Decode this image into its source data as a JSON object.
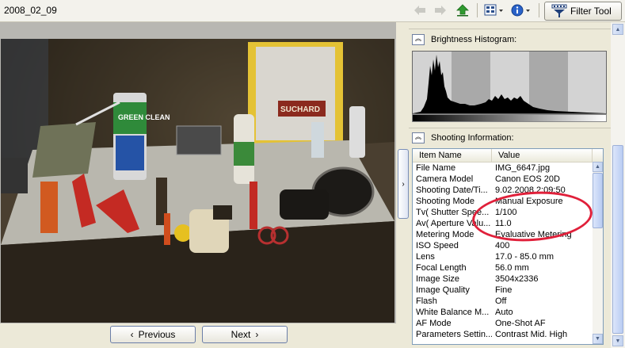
{
  "header": {
    "folder_title": "2008_02_09",
    "filter_label": "Filter Tool",
    "icons": [
      "back-arrow-icon",
      "forward-arrow-icon",
      "up-folder-icon",
      "view-mode-icon",
      "info-icon",
      "filter-icon"
    ]
  },
  "viewer": {
    "prev_label": "Previous",
    "next_label": "Next",
    "photo_sign_text": "SUCHARD",
    "spray_can_text": "GREEN CLEAN"
  },
  "panel": {
    "histogram_title": "Brightness Histogram:",
    "shooting_title": "Shooting Information:",
    "columns": {
      "name": "Item Name",
      "value": "Value"
    },
    "rows": [
      {
        "name": "File Name",
        "value": "IMG_6647.jpg"
      },
      {
        "name": "Camera Model",
        "value": "Canon EOS 20D"
      },
      {
        "name": "Shooting Date/Ti...",
        "value": "9.02.2008 2:09:50"
      },
      {
        "name": "Shooting Mode",
        "value": "Manual Exposure"
      },
      {
        "name": "Tv( Shutter Spee...",
        "value": "1/100"
      },
      {
        "name": "Av( Aperture Valu...",
        "value": "11.0"
      },
      {
        "name": "Metering Mode",
        "value": "Evaluative Metering"
      },
      {
        "name": "ISO Speed",
        "value": "400"
      },
      {
        "name": "Lens",
        "value": "17.0 - 85.0 mm"
      },
      {
        "name": "Focal Length",
        "value": "56.0 mm"
      },
      {
        "name": "Image Size",
        "value": "3504x2336"
      },
      {
        "name": "Image Quality",
        "value": "Fine"
      },
      {
        "name": "Flash",
        "value": "Off"
      },
      {
        "name": "White Balance M...",
        "value": "Auto"
      },
      {
        "name": "AF Mode",
        "value": "One-Shot AF"
      },
      {
        "name": "Parameters Settin...",
        "value": "Contrast Mid. High"
      }
    ]
  },
  "colors": {
    "annotation": "#e0203a",
    "accent": "#316ac5"
  }
}
